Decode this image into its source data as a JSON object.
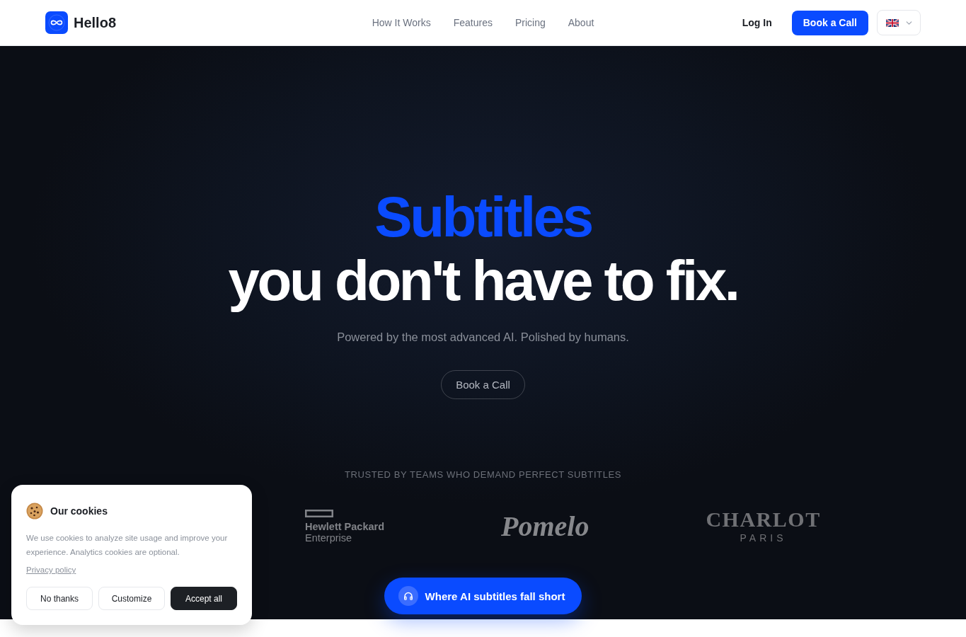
{
  "header": {
    "brand": "Hello8",
    "nav": [
      "How It Works",
      "Features",
      "Pricing",
      "About"
    ],
    "login": "Log In",
    "cta": "Book a Call"
  },
  "hero": {
    "title_accent": "Subtitles",
    "title": "you don't have to fix.",
    "subtitle": "Powered by the most advanced AI. Polished by humans.",
    "cta": "Book a Call"
  },
  "trusted": {
    "label": "TRUSTED BY TEAMS WHO DEMAND PERFECT SUBTITLES",
    "logos": [
      {
        "kind": "boxed",
        "lines": [
          "Hewlett Packard",
          "Enterprise"
        ]
      },
      {
        "kind": "script",
        "lines": [
          "Pomelo"
        ]
      },
      {
        "kind": "serif",
        "lines": [
          "CHARLOT",
          "PARIS"
        ]
      }
    ]
  },
  "floating_button": {
    "label": "Where AI subtitles fall short"
  },
  "cookie_banner": {
    "title": "Our cookies",
    "text": "We use cookies to analyze site usage and improve your experience. Analytics cookies are optional.",
    "link": "Privacy policy",
    "buttons": [
      {
        "label": "No thanks",
        "kind": "secondary"
      },
      {
        "label": "Customize",
        "kind": "secondary"
      },
      {
        "label": "Accept all",
        "kind": "primary"
      }
    ]
  }
}
